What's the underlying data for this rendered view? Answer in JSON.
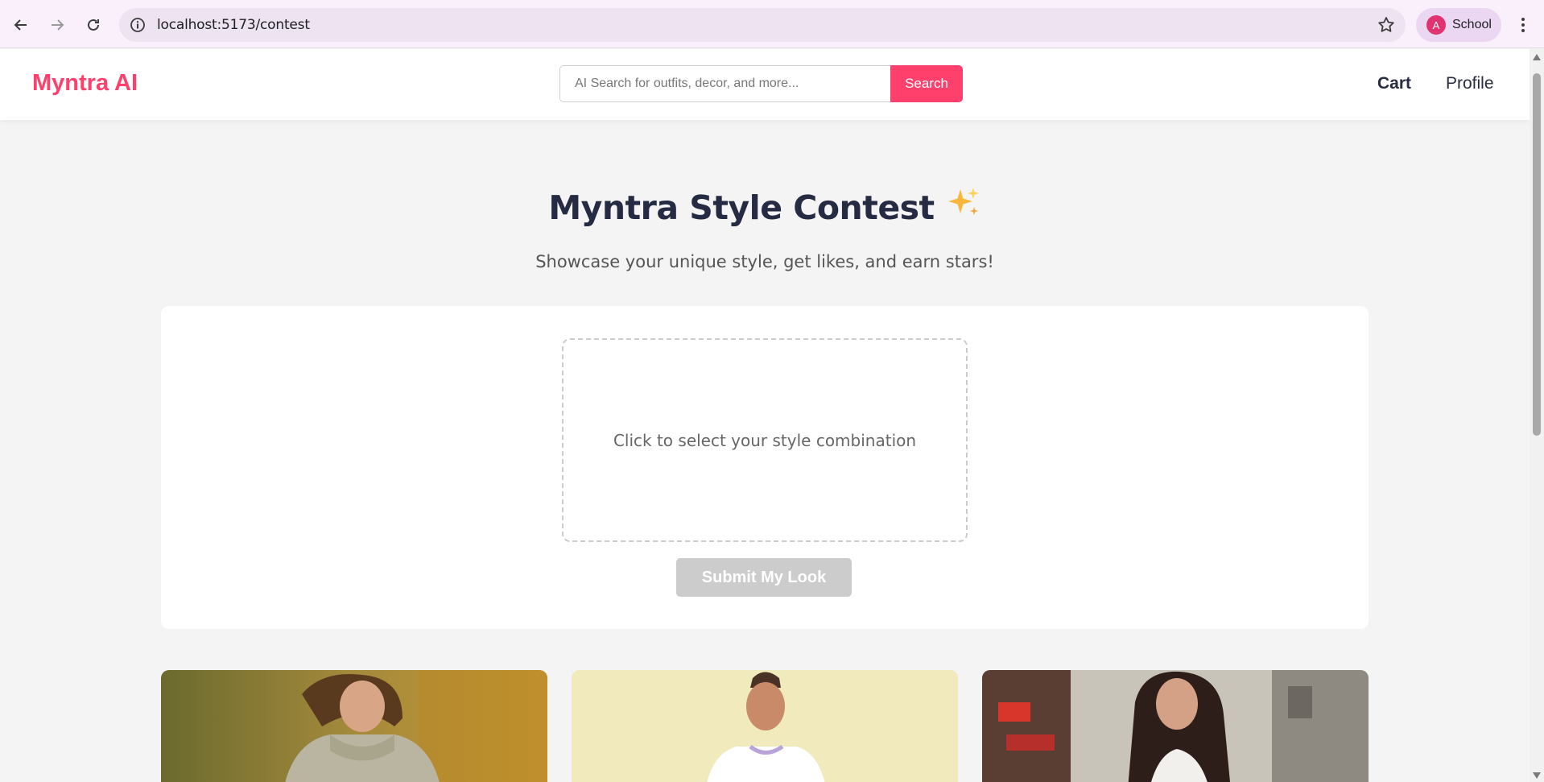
{
  "browser": {
    "url": "localhost:5173/contest",
    "profile_initial": "A",
    "profile_name": "School"
  },
  "header": {
    "logo": "Myntra AI",
    "search_placeholder": "AI Search for outfits, decor, and more...",
    "search_button": "Search",
    "nav": {
      "cart": "Cart",
      "profile": "Profile"
    }
  },
  "contest": {
    "title": "Myntra Style Contest",
    "title_emoji": "✨",
    "subtitle": "Showcase your unique style, get likes, and earn stars!",
    "dropzone_label": "Click to select your style combination",
    "submit_label": "Submit My Look"
  },
  "colors": {
    "brand": "#ff3f6c",
    "heading": "#242b42",
    "disabled_button": "#cccccc"
  },
  "icons": [
    "back-arrow-icon",
    "forward-arrow-icon",
    "reload-icon",
    "site-info-icon",
    "bookmark-star-icon",
    "more-menu-icon",
    "sparkles-icon"
  ]
}
